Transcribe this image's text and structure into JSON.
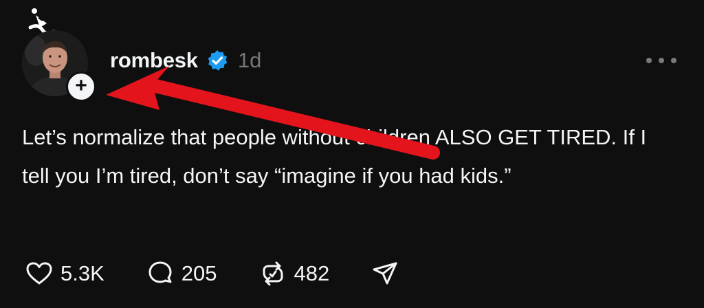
{
  "post": {
    "username": "rombesk",
    "timestamp": "1d",
    "text": "Let’s normalize that people without children ALSO GET TIRED. If I tell you I’m tired, don’t say “imagine if you had kids.”",
    "follow_symbol": "+",
    "icons": {
      "avatar": "avatar",
      "hat": "party-hat-icon",
      "verified": "verified-badge-icon",
      "more": "more-options-icon",
      "like": "heart-icon",
      "reply": "comment-icon",
      "repost": "repost-icon",
      "share": "share-icon",
      "annotation": "red-arrow"
    }
  },
  "actions": {
    "likes": "5.3K",
    "replies": "205",
    "reposts": "482"
  },
  "colors": {
    "background": "#0f0f0f",
    "text": "#f3f5f7",
    "muted": "#777777",
    "verified": "#1d9bf0",
    "annotation": "#e3141b"
  }
}
